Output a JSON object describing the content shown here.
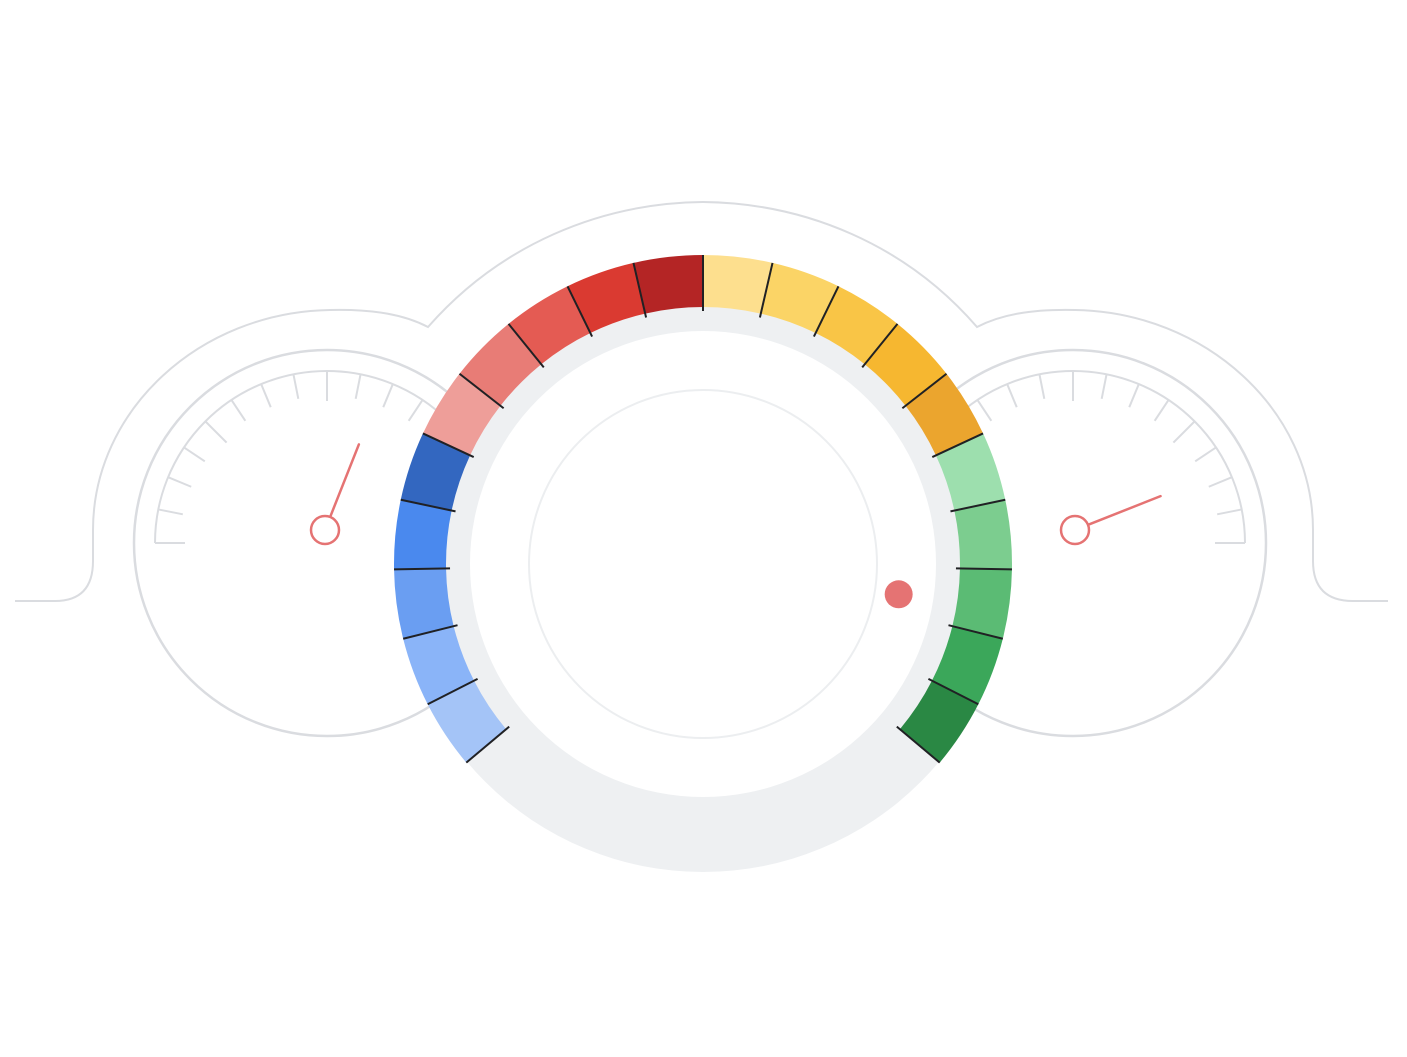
{
  "colors": {
    "background": "#ffffff",
    "outline": "#dadce0",
    "inner_ring": "#eceef0",
    "track": "#eef0f2",
    "tick_dark": "#202124",
    "needle": "#e57373",
    "knob_dot": "#e57373"
  },
  "left_gauge": {
    "needle_level": 0.62
  },
  "right_gauge": {
    "needle_level": 0.88
  },
  "dial": {
    "segments": [
      {
        "group": "blue",
        "color": "#a4c4f7"
      },
      {
        "group": "blue",
        "color": "#8ab4f8"
      },
      {
        "group": "blue",
        "color": "#6a9ef2"
      },
      {
        "group": "blue",
        "color": "#4a89ee"
      },
      {
        "group": "blue",
        "color": "#3367c0"
      },
      {
        "group": "red",
        "color": "#ee9e99"
      },
      {
        "group": "red",
        "color": "#e87c76"
      },
      {
        "group": "red",
        "color": "#e45b53"
      },
      {
        "group": "red",
        "color": "#da3a31"
      },
      {
        "group": "red",
        "color": "#b42525"
      },
      {
        "group": "yellow",
        "color": "#fddf8e"
      },
      {
        "group": "yellow",
        "color": "#fbd466"
      },
      {
        "group": "yellow",
        "color": "#f9c546"
      },
      {
        "group": "yellow",
        "color": "#f6b730"
      },
      {
        "group": "yellow",
        "color": "#eba52e"
      },
      {
        "group": "green",
        "color": "#9ddfae"
      },
      {
        "group": "green",
        "color": "#7ccd8f"
      },
      {
        "group": "green",
        "color": "#5bbb74"
      },
      {
        "group": "green",
        "color": "#3ba75a"
      },
      {
        "group": "green",
        "color": "#2a8844"
      }
    ],
    "knob_level": 0.88
  }
}
